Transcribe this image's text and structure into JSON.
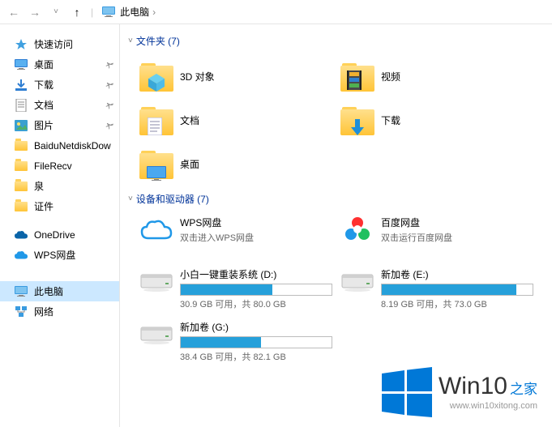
{
  "nav": {
    "location": "此电脑"
  },
  "sidebar": {
    "items": [
      {
        "label": "快速访问",
        "icon": "star",
        "pinned": false
      },
      {
        "label": "桌面",
        "icon": "desktop",
        "pinned": true
      },
      {
        "label": "下载",
        "icon": "download",
        "pinned": true
      },
      {
        "label": "文档",
        "icon": "document",
        "pinned": true
      },
      {
        "label": "图片",
        "icon": "picture",
        "pinned": true
      },
      {
        "label": "BaiduNetdiskDow",
        "icon": "folder",
        "pinned": false
      },
      {
        "label": "FileRecv",
        "icon": "folder",
        "pinned": false
      },
      {
        "label": "泉",
        "icon": "folder",
        "pinned": false
      },
      {
        "label": "证件",
        "icon": "folder",
        "pinned": false
      },
      {
        "label": "OneDrive",
        "icon": "onedrive",
        "pinned": false
      },
      {
        "label": "WPS网盘",
        "icon": "wpscloud",
        "pinned": false
      },
      {
        "label": "此电脑",
        "icon": "pc",
        "pinned": false,
        "selected": true
      },
      {
        "label": "网络",
        "icon": "network",
        "pinned": false
      }
    ]
  },
  "sections": {
    "folders_title": "文件夹 (7)",
    "drives_title": "设备和驱动器 (7)"
  },
  "folders": [
    {
      "label": "3D 对象",
      "overlay": "cube"
    },
    {
      "label": "视频",
      "overlay": "film"
    },
    {
      "label": "文档",
      "overlay": "doc"
    },
    {
      "label": "下载",
      "overlay": "down"
    },
    {
      "label": "桌面",
      "overlay": "desk"
    }
  ],
  "drives": [
    {
      "name": "WPS网盘",
      "sub": "双击进入WPS网盘",
      "icon": "wps",
      "progress": null
    },
    {
      "name": "百度网盘",
      "sub": "双击运行百度网盘",
      "icon": "baidu",
      "progress": null
    },
    {
      "name": "小白一键重装系统 (D:)",
      "sub": "30.9 GB 可用，共 80.0 GB",
      "icon": "disk",
      "progress": 61
    },
    {
      "name": "新加卷 (E:)",
      "sub": "8.19 GB 可用，共 73.0 GB",
      "icon": "disk",
      "progress": 89
    },
    {
      "name": "新加卷 (G:)",
      "sub": "38.4 GB 可用，共 82.1 GB",
      "icon": "disk",
      "progress": 53
    }
  ],
  "watermark": {
    "title_main": "Win10",
    "title_suffix": "之家",
    "url": "www.win10xitong.com"
  }
}
